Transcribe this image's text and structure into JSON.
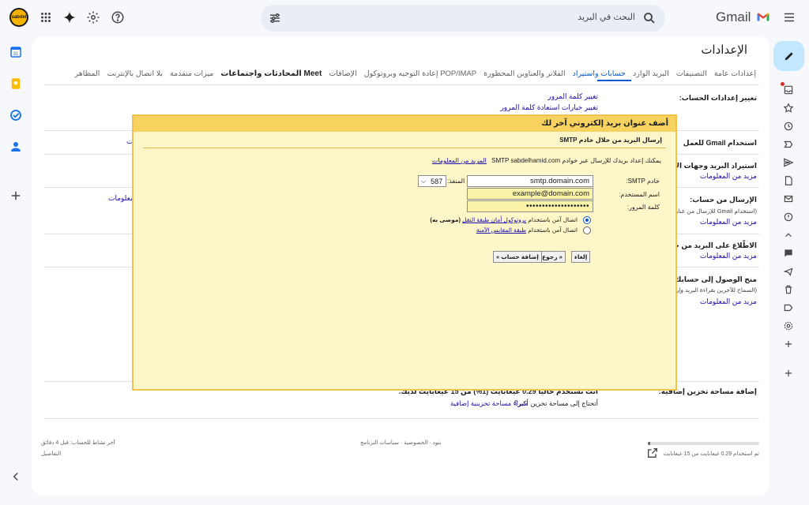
{
  "app": {
    "brand": "Gmail",
    "avatar_text": "sabdel"
  },
  "search": {
    "placeholder": "البحث في البريد"
  },
  "page": {
    "title": "الإعدادات"
  },
  "tabs": [
    {
      "label": "إعدادات عامة",
      "active": false
    },
    {
      "label": "التصنيفات",
      "active": false
    },
    {
      "label": "البريد الوارد",
      "active": false
    },
    {
      "label": "حسابات واستيراد",
      "active": true
    },
    {
      "label": "الفلاتر والعناوين المحظورة",
      "active": false
    },
    {
      "label": "إعادة التوجيه وبروتوكول POP/IMAP",
      "active": false
    },
    {
      "label": "الإضافات",
      "active": false
    },
    {
      "label": "المحادثات واجتماعات Meet",
      "active": false
    },
    {
      "label": "ميزات متقدمة",
      "active": false
    },
    {
      "label": "بلا اتصال بالإنترنت",
      "active": false
    },
    {
      "label": "المظاهر",
      "active": false
    }
  ],
  "settings": {
    "change_account": {
      "label": "تغيير إعدادات الحساب:",
      "link1": "تغيير كلمة المرور",
      "link2": "تغيير خيارات استعادة كلمة المرور"
    },
    "use_gmail_for_work": {
      "label": "استخدام Gmail للعمل"
    },
    "import": {
      "label": "استيراد البريد وجهات الاتصال:",
      "learn_more": "مزيد من المعلومات"
    },
    "send_as": {
      "label": "الإرسال من حساب:",
      "sub": "(استخدام Gmail للإرسال من عناوين",
      "learn_more": "مزيد من المعلومات"
    },
    "check_mail": {
      "label": "الاطّلاع على البريد من حسابات",
      "learn_more": "مزيد من المعلومات"
    },
    "grant_access": {
      "label": "منح الوصول إلى حسابك:",
      "sub": "(السماح للآخرين بقراءة البريد وإرسال",
      "learn_more": "مزيد من المعلومات"
    },
    "add_storage": {
      "label": "إضافة مساحة تخزين إضافية:",
      "usage_text": "أنت تستخدم حاليًا 0.29 غيغابايت (1%) من 15 غيغابايت لديك.",
      "question": "أتحتاج إلى مساحة تخزين أكبر؟",
      "buy_link": "شراء مساحة تخزينية إضافية"
    },
    "left_partial_link": "معلومات",
    "left_partial_char": "ت"
  },
  "footer": {
    "storage_text": "تم استخدام 0.29 غيغابايت من 15 غيغابايت",
    "storage_fraction": 0.02,
    "terms": "بنود · الخصوصية · سياسات البرنامج",
    "last_activity": "آخر نشاط للحساب: قبل 4 دقائق",
    "details": "التفاصيل"
  },
  "dialog": {
    "title": "أضف عنوان بريد إلكتروني آخر لك",
    "subtitle": "إرسال البريد من خلال خادم SMTP",
    "info": "يمكنك إعداد بريدك للإرسال عبر خوادم SMTP sabdelhamid.com",
    "info_link": "المزيد من المعلومات",
    "smtp_label": "خادم SMTP:",
    "smtp_value": "smtp.domain.com",
    "port_label": "المنفذ:",
    "port_value": "587",
    "user_label": "اسم المستخدم:",
    "user_value": "example@domain.com",
    "pass_label": "كلمة المرور:",
    "pass_value": "••••••••••••••••••••",
    "radio1_prefix": "اتصال آمن باستخدام",
    "radio1_link": "بروتوكول أمان طبقة النقل",
    "radio1_suffix": "(موصى به)",
    "radio2_prefix": "اتصال آمن باستخدام",
    "radio2_link": "طبقة المقابس الآمنة",
    "cancel": "إلغاء",
    "back": "« رجوع",
    "add": "إضافة حساب »"
  }
}
